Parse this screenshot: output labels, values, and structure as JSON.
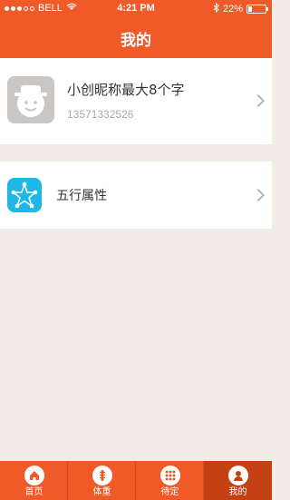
{
  "status_bar": {
    "carrier": "BELL",
    "time": "4:21 PM",
    "battery_percent": "22%",
    "battery_level": 0.22
  },
  "nav": {
    "title": "我的"
  },
  "profile": {
    "nickname": "小创昵称最大8个字",
    "phone": "13571332526"
  },
  "menu": {
    "wuxing_label": "五行属性"
  },
  "tabs": [
    {
      "label": "首页",
      "icon": "home-icon"
    },
    {
      "label": "体重",
      "icon": "weight-icon"
    },
    {
      "label": "待定",
      "icon": "grid-icon"
    },
    {
      "label": "我的",
      "icon": "user-icon"
    }
  ],
  "colors": {
    "primary": "#f05a28",
    "active_tab": "#c54012",
    "background": "#f1ece6",
    "wuxing_icon": "#1fb8e6"
  }
}
